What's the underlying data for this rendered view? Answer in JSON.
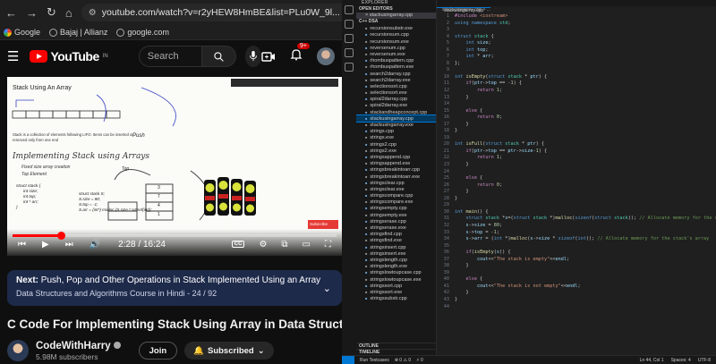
{
  "browser": {
    "url": "youtube.com/watch?v=r2yHEW8HmBE&list=PLu0W_9l...",
    "bookmarks": [
      "Google",
      "Bajaj | Allianz",
      "google.com"
    ],
    "profile_initial": "R"
  },
  "youtube": {
    "logo_text": "YouTube",
    "logo_sup": "IN",
    "search_placeholder": "Search",
    "notification_count": "9+",
    "video": {
      "current_time": "2:28",
      "duration": "16:24",
      "time_display": "2:28 / 16:24",
      "progress": 0.15,
      "slide": {
        "title": "Stack Using An Array",
        "desc": "Stack is a collection of elements following LIFO. Items can be inserted or removed only from one end",
        "heading": "Implementing Stack using Arrays",
        "bullets": [
          "Fixed size array creation",
          "Top Element"
        ],
        "struct_lines": [
          "struct stack {",
          "int size;",
          "int top;",
          "int * arr;",
          "}"
        ],
        "code_lines": [
          "struct stack S;",
          "S.size = 80;",
          "S.top = -1;",
          "S.arr = (int*) malloc (S.size * sizeof(int));"
        ],
        "push_label": "Push",
        "top_label": "Top",
        "stack_values": [
          "3",
          "7",
          "4",
          "1"
        ],
        "subscribe_label": "Subscribe"
      }
    },
    "next": {
      "label": "Next:",
      "title": "Push, Pop and Other Operations in Stack Implemented Using an Array",
      "playlist": "Data Structures and Algorithms Course in Hindi - 24 / 92"
    },
    "title": "C Code For Implementing Stack Using Array in Data Structures",
    "channel": {
      "name": "CodeWithHarry",
      "subscribers": "5.98M subscribers",
      "join_label": "Join",
      "subscribed_label": "Subscribed"
    }
  },
  "vscode": {
    "explorer_title": "EXPLORER",
    "open_editors_label": "OPEN EDITORS",
    "open_file": "× stackusingarray.cpp",
    "folder_label": "C++ DSA",
    "files": [
      "recursionsubstr.exe",
      "recursionsum.cpp",
      "recursionsum.exe",
      "reversenum.cpp",
      "reversenum.exe",
      "rhombuspattern.cpp",
      "rhombuspattern.exe",
      "search2darray.cpp",
      "search2darray.exe",
      "selectionsort.cpp",
      "selectionsort.exe",
      "spiral2darray.cpp",
      "spiral2darray.exe",
      "stackandheapconcept.cpp",
      "stackusingarray.cpp",
      "stackusingarray.exe",
      "strings.cpp",
      "strings.exe",
      "strings2.cpp",
      "strings2.exe",
      "stringsappend.cpp",
      "stringsappend.exe",
      "stringsbreakintoarr.cpp",
      "stringsbreakintoarr.exe",
      "stringsclear.cpp",
      "stringsclear.exe",
      "stringscompare.cpp",
      "stringscompare.exe",
      "stringsempty.cpp",
      "stringsempty.exe",
      "stringserase.cpp",
      "stringserase.exe",
      "stringsfind.cpp",
      "stringsfind.exe",
      "stringsinsert.cpp",
      "stringsinsert.exe",
      "stringslength.cpp",
      "stringslength.exe",
      "stringslowtoupcase.cpp",
      "stringslowtoupcase.exe",
      "stringssort.cpp",
      "stringssort.exe",
      "stringssubstr.cpp"
    ],
    "selected_file_index": 14,
    "outline_label": "OUTLINE",
    "timeline_label": "TIMELINE",
    "tab_label": "stackusingarray.cpp",
    "breadcrumb": "stackusingarray.cpp > ...",
    "status": {
      "left": "Run Testcases",
      "problems": "⊗ 0 ⚠ 0",
      "ports": "⚡ 0",
      "position": "Ln 44, Col 1",
      "spaces": "Spaces: 4",
      "encoding": "UTF-8"
    }
  }
}
